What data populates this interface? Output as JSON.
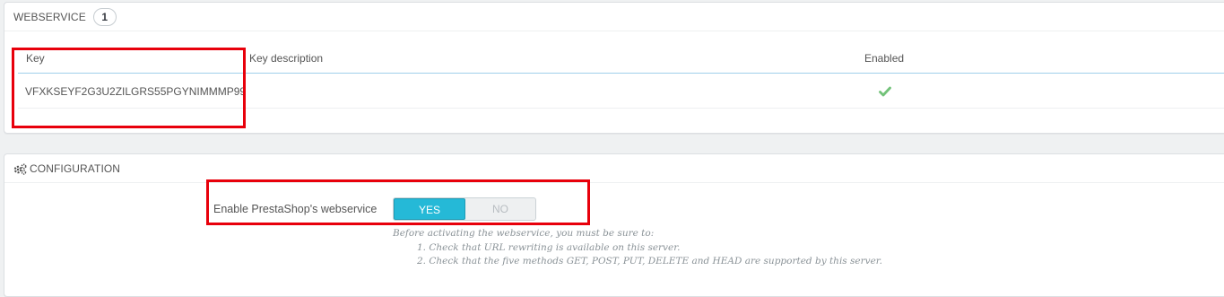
{
  "webservice_panel": {
    "title": "WEBSERVICE",
    "count": "1",
    "columns": [
      "Key",
      "Key description",
      "Enabled"
    ],
    "rows": [
      {
        "key": "VFXKSEYF2G3U2ZILGRS55PGYNIMMMP99",
        "description": "",
        "enabled": true
      }
    ]
  },
  "config_panel": {
    "title": "CONFIGURATION",
    "enable_label": "Enable PrestaShop's webservice",
    "switch": {
      "yes": "YES",
      "no": "NO",
      "selected": "YES"
    },
    "help_intro": "Before activating the webservice, you must be sure to:",
    "help_items": [
      "1. Check that URL rewriting is available on this server.",
      "2. Check that the five methods GET, POST, PUT, DELETE and HEAD are supported by this server."
    ]
  },
  "colors": {
    "accent": "#25b9d7",
    "highlight": "#e8000b",
    "check": "#72c279"
  },
  "icons": {
    "enabled": "check-icon",
    "config": "gears-icon"
  }
}
